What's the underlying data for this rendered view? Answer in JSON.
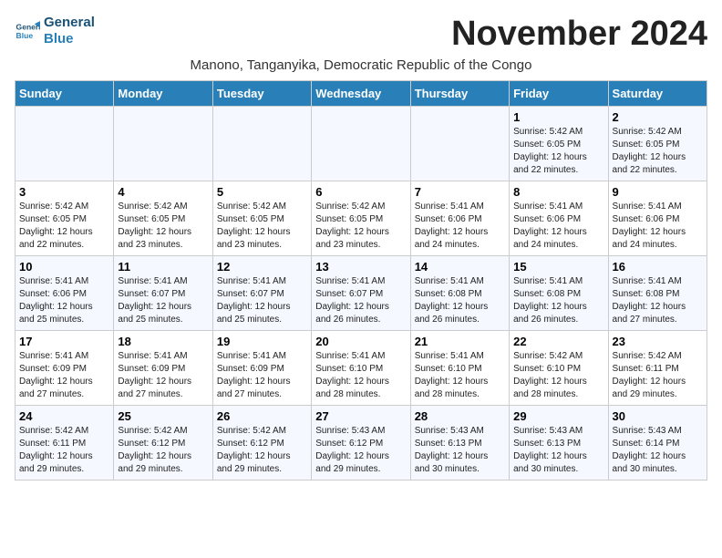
{
  "header": {
    "logo_line1": "General",
    "logo_line2": "Blue",
    "month_title": "November 2024",
    "subtitle": "Manono, Tanganyika, Democratic Republic of the Congo"
  },
  "weekdays": [
    "Sunday",
    "Monday",
    "Tuesday",
    "Wednesday",
    "Thursday",
    "Friday",
    "Saturday"
  ],
  "weeks": [
    [
      {
        "day": "",
        "info": ""
      },
      {
        "day": "",
        "info": ""
      },
      {
        "day": "",
        "info": ""
      },
      {
        "day": "",
        "info": ""
      },
      {
        "day": "",
        "info": ""
      },
      {
        "day": "1",
        "info": "Sunrise: 5:42 AM\nSunset: 6:05 PM\nDaylight: 12 hours and 22 minutes."
      },
      {
        "day": "2",
        "info": "Sunrise: 5:42 AM\nSunset: 6:05 PM\nDaylight: 12 hours and 22 minutes."
      }
    ],
    [
      {
        "day": "3",
        "info": "Sunrise: 5:42 AM\nSunset: 6:05 PM\nDaylight: 12 hours and 22 minutes."
      },
      {
        "day": "4",
        "info": "Sunrise: 5:42 AM\nSunset: 6:05 PM\nDaylight: 12 hours and 23 minutes."
      },
      {
        "day": "5",
        "info": "Sunrise: 5:42 AM\nSunset: 6:05 PM\nDaylight: 12 hours and 23 minutes."
      },
      {
        "day": "6",
        "info": "Sunrise: 5:42 AM\nSunset: 6:05 PM\nDaylight: 12 hours and 23 minutes."
      },
      {
        "day": "7",
        "info": "Sunrise: 5:41 AM\nSunset: 6:06 PM\nDaylight: 12 hours and 24 minutes."
      },
      {
        "day": "8",
        "info": "Sunrise: 5:41 AM\nSunset: 6:06 PM\nDaylight: 12 hours and 24 minutes."
      },
      {
        "day": "9",
        "info": "Sunrise: 5:41 AM\nSunset: 6:06 PM\nDaylight: 12 hours and 24 minutes."
      }
    ],
    [
      {
        "day": "10",
        "info": "Sunrise: 5:41 AM\nSunset: 6:06 PM\nDaylight: 12 hours and 25 minutes."
      },
      {
        "day": "11",
        "info": "Sunrise: 5:41 AM\nSunset: 6:07 PM\nDaylight: 12 hours and 25 minutes."
      },
      {
        "day": "12",
        "info": "Sunrise: 5:41 AM\nSunset: 6:07 PM\nDaylight: 12 hours and 25 minutes."
      },
      {
        "day": "13",
        "info": "Sunrise: 5:41 AM\nSunset: 6:07 PM\nDaylight: 12 hours and 26 minutes."
      },
      {
        "day": "14",
        "info": "Sunrise: 5:41 AM\nSunset: 6:08 PM\nDaylight: 12 hours and 26 minutes."
      },
      {
        "day": "15",
        "info": "Sunrise: 5:41 AM\nSunset: 6:08 PM\nDaylight: 12 hours and 26 minutes."
      },
      {
        "day": "16",
        "info": "Sunrise: 5:41 AM\nSunset: 6:08 PM\nDaylight: 12 hours and 27 minutes."
      }
    ],
    [
      {
        "day": "17",
        "info": "Sunrise: 5:41 AM\nSunset: 6:09 PM\nDaylight: 12 hours and 27 minutes."
      },
      {
        "day": "18",
        "info": "Sunrise: 5:41 AM\nSunset: 6:09 PM\nDaylight: 12 hours and 27 minutes."
      },
      {
        "day": "19",
        "info": "Sunrise: 5:41 AM\nSunset: 6:09 PM\nDaylight: 12 hours and 27 minutes."
      },
      {
        "day": "20",
        "info": "Sunrise: 5:41 AM\nSunset: 6:10 PM\nDaylight: 12 hours and 28 minutes."
      },
      {
        "day": "21",
        "info": "Sunrise: 5:41 AM\nSunset: 6:10 PM\nDaylight: 12 hours and 28 minutes."
      },
      {
        "day": "22",
        "info": "Sunrise: 5:42 AM\nSunset: 6:10 PM\nDaylight: 12 hours and 28 minutes."
      },
      {
        "day": "23",
        "info": "Sunrise: 5:42 AM\nSunset: 6:11 PM\nDaylight: 12 hours and 29 minutes."
      }
    ],
    [
      {
        "day": "24",
        "info": "Sunrise: 5:42 AM\nSunset: 6:11 PM\nDaylight: 12 hours and 29 minutes."
      },
      {
        "day": "25",
        "info": "Sunrise: 5:42 AM\nSunset: 6:12 PM\nDaylight: 12 hours and 29 minutes."
      },
      {
        "day": "26",
        "info": "Sunrise: 5:42 AM\nSunset: 6:12 PM\nDaylight: 12 hours and 29 minutes."
      },
      {
        "day": "27",
        "info": "Sunrise: 5:43 AM\nSunset: 6:12 PM\nDaylight: 12 hours and 29 minutes."
      },
      {
        "day": "28",
        "info": "Sunrise: 5:43 AM\nSunset: 6:13 PM\nDaylight: 12 hours and 30 minutes."
      },
      {
        "day": "29",
        "info": "Sunrise: 5:43 AM\nSunset: 6:13 PM\nDaylight: 12 hours and 30 minutes."
      },
      {
        "day": "30",
        "info": "Sunrise: 5:43 AM\nSunset: 6:14 PM\nDaylight: 12 hours and 30 minutes."
      }
    ]
  ]
}
